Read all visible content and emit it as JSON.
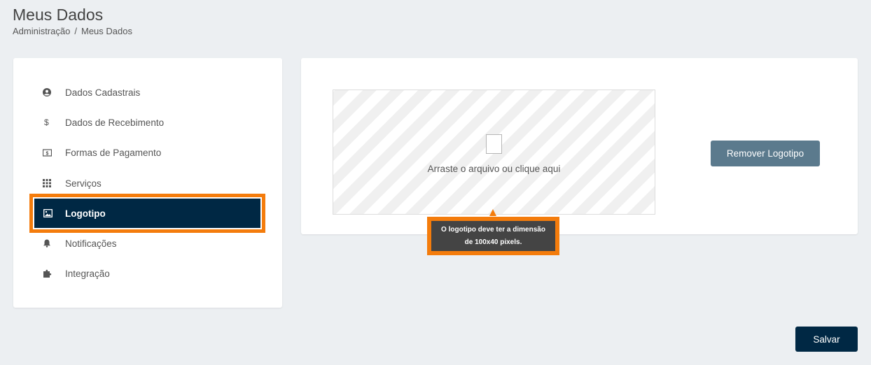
{
  "header": {
    "title": "Meus Dados",
    "breadcrumb": [
      "Administração",
      "/",
      "Meus Dados"
    ]
  },
  "sidebar": {
    "items": [
      {
        "label": "Dados Cadastrais",
        "icon": "user-circle-icon"
      },
      {
        "label": "Dados de Recebimento",
        "icon": "dollar-icon"
      },
      {
        "label": "Formas de Pagamento",
        "icon": "money-bill-icon"
      },
      {
        "label": "Serviços",
        "icon": "grid-icon"
      },
      {
        "label": "Logotipo",
        "icon": "image-icon",
        "active": true
      },
      {
        "label": "Notificações",
        "icon": "bell-icon"
      },
      {
        "label": "Integração",
        "icon": "puzzle-icon"
      }
    ]
  },
  "main": {
    "dropzone_text": "Arraste o arquivo ou clique aqui",
    "remove_button": "Remover Logotipo",
    "tooltip_line1": "O logotipo deve ter a dimensão",
    "tooltip_line2": "de 100x40 pixels."
  },
  "footer": {
    "save_button": "Salvar"
  },
  "colors": {
    "background": "#eceff2",
    "active_item": "#002844",
    "highlight": "#f47c0c",
    "remove_button": "#5b7a8d",
    "save_button": "#002844"
  }
}
